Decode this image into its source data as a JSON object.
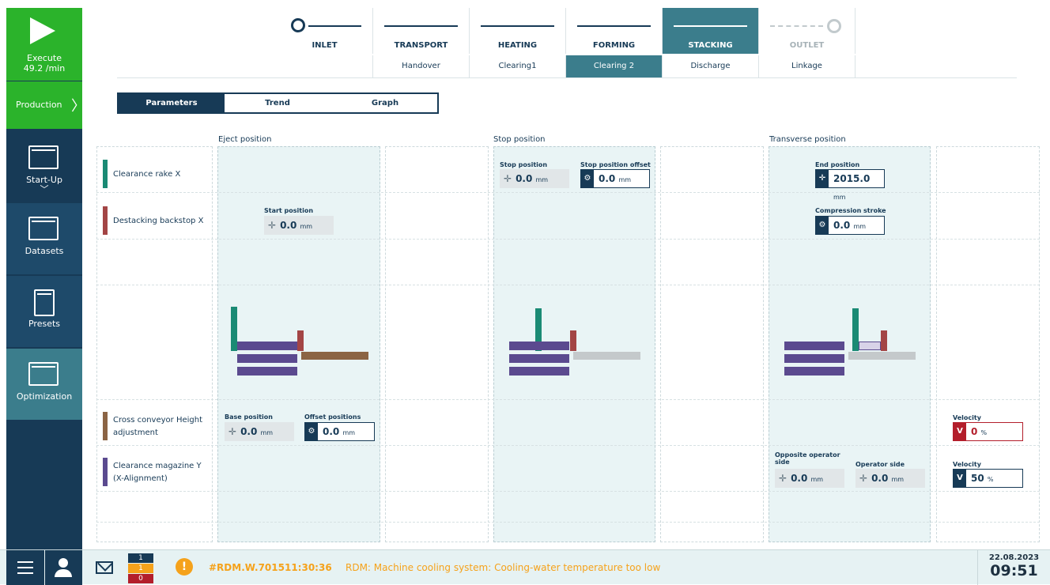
{
  "sidebar": {
    "execute": {
      "label": "Execute",
      "rate": "49.2 /min"
    },
    "production": {
      "label": "Production",
      "chevron": "〉"
    },
    "items": [
      {
        "label": "Start-Up",
        "icon": "startup-icon"
      },
      {
        "label": "Datasets",
        "icon": "datasets-icon"
      },
      {
        "label": "Presets",
        "icon": "presets-icon"
      },
      {
        "label": "Optimization",
        "icon": "optimization-icon"
      }
    ]
  },
  "stages": [
    {
      "label": "INLET",
      "state": "normal"
    },
    {
      "label": "TRANSPORT",
      "state": "normal"
    },
    {
      "label": "HEATING",
      "state": "normal"
    },
    {
      "label": "FORMING",
      "state": "normal"
    },
    {
      "label": "STACKING",
      "state": "active"
    },
    {
      "label": "OUTLET",
      "state": "dim"
    }
  ],
  "substages": [
    {
      "label": ""
    },
    {
      "label": "Handover"
    },
    {
      "label": "Clearing1"
    },
    {
      "label": "Clearing 2",
      "active": true
    },
    {
      "label": "Discharge"
    },
    {
      "label": "Linkage"
    }
  ],
  "view_tabs": [
    {
      "label": "Parameters",
      "active": true
    },
    {
      "label": "Trend"
    },
    {
      "label": "Graph"
    }
  ],
  "sections": {
    "eject": "Eject position",
    "stop": "Stop position",
    "transverse": "Transverse position"
  },
  "rows": [
    {
      "label": "Clearance rake X",
      "color": "#1a8a74"
    },
    {
      "label": "Destacking backstop X",
      "color": "#a34545"
    },
    {
      "label": "Cross conveyor Height adjustment",
      "color": "#8b6444"
    },
    {
      "label": "Clearance magazine Y (X-Alignment)",
      "color": "#5b4a8f"
    }
  ],
  "fields": {
    "start_position": {
      "label": "Start position",
      "value": "0.0",
      "unit": "mm"
    },
    "stop_position": {
      "label": "Stop position",
      "value": "0.0",
      "unit": "mm"
    },
    "stop_position_offset": {
      "label": "Stop position offset",
      "value": "0.0",
      "unit": "mm"
    },
    "end_position": {
      "label": "End position",
      "value": "2015.0",
      "unit": "mm"
    },
    "compression_stroke": {
      "label": "Compression stroke",
      "value": "0.0",
      "unit": "mm"
    },
    "base_position": {
      "label": "Base position",
      "value": "0.0",
      "unit": "mm"
    },
    "offset_positions": {
      "label": "Offset positions",
      "value": "0.0",
      "unit": "mm"
    },
    "velocity_cross": {
      "label": "Velocity",
      "prefix": "V",
      "value": "0",
      "unit": "%"
    },
    "opposite_operator_side": {
      "label": "Opposite operator side",
      "value": "0.0",
      "unit": "mm"
    },
    "operator_side": {
      "label": "Operator side",
      "value": "0.0",
      "unit": "mm"
    },
    "velocity_magazine": {
      "label": "Velocity",
      "prefix": "V",
      "value": "50",
      "unit": "%"
    }
  },
  "bottom": {
    "counters": [
      "1",
      "1",
      "0"
    ],
    "alarm_code": "#RDM.W.701511:30:36",
    "alarm_msg": "RDM: Machine cooling system: Cooling-water temperature too low",
    "date": "22.08.2023",
    "time": "09:51",
    "warn_symbol": "!"
  },
  "colors": {
    "navy": "#173a56",
    "green": "#2bb32b",
    "teal": "#3b7d8c",
    "warning": "#f5a21b",
    "alert": "#b31e2b"
  }
}
